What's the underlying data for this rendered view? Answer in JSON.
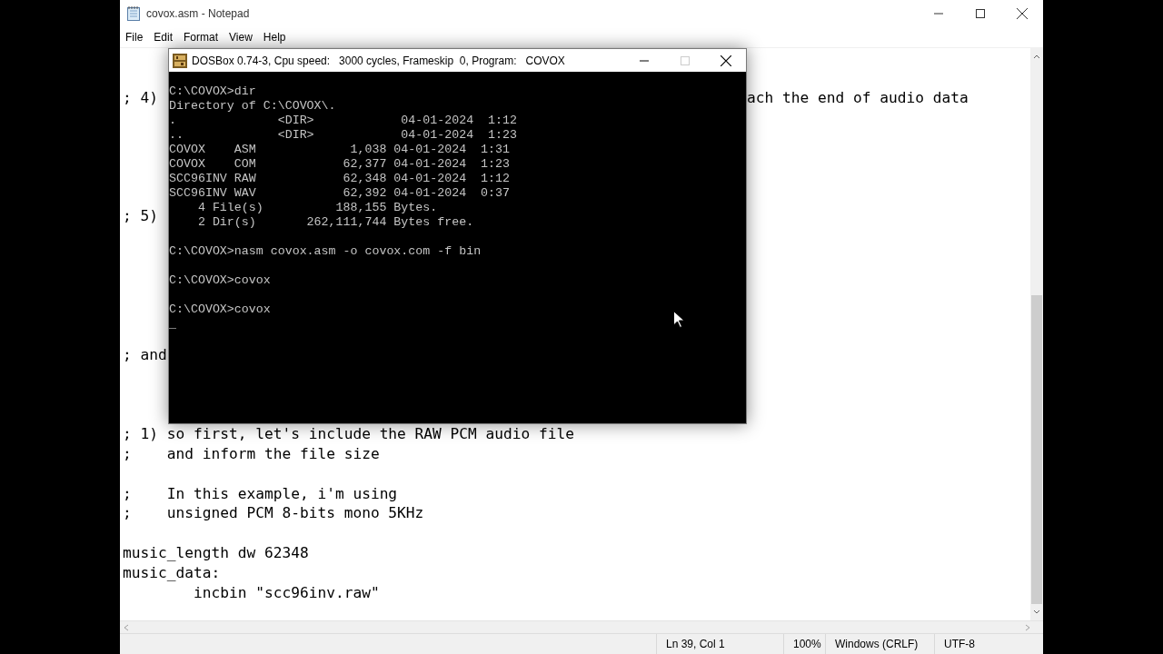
{
  "notepad": {
    "title": "covox.asm - Notepad",
    "menu": [
      "File",
      "Edit",
      "Format",
      "View",
      "Help"
    ],
    "lines": [
      {
        "kind": "blank"
      },
      {
        "kind": "blank"
      },
      {
        "kind": "text",
        "text": "; 4)",
        "tail": "ach the end of audio data"
      },
      {
        "kind": "blank"
      },
      {
        "kind": "blank"
      },
      {
        "kind": "blank"
      },
      {
        "kind": "blank"
      },
      {
        "kind": "blank"
      },
      {
        "kind": "text",
        "text": "; 5)"
      },
      {
        "kind": "blank"
      },
      {
        "kind": "blank"
      },
      {
        "kind": "blank"
      },
      {
        "kind": "blank"
      },
      {
        "kind": "blank"
      },
      {
        "kind": "blank"
      },
      {
        "kind": "text",
        "text": "; and"
      },
      {
        "kind": "blank"
      },
      {
        "kind": "blank"
      },
      {
        "kind": "blank"
      },
      {
        "kind": "text",
        "text": "; 1) so first, let's include the RAW PCM audio file"
      },
      {
        "kind": "text",
        "text": ";    and inform the file size"
      },
      {
        "kind": "blank"
      },
      {
        "kind": "text",
        "text": ";    In this example, i'm using"
      },
      {
        "kind": "text",
        "text": ";    unsigned PCM 8-bits mono 5KHz"
      },
      {
        "kind": "blank"
      },
      {
        "kind": "text",
        "text": "music_length dw 62348"
      },
      {
        "kind": "text",
        "text": "music_data:"
      },
      {
        "kind": "text",
        "text": "        incbin \"scc96inv.raw\""
      }
    ],
    "status_bar": [
      "Ln 39, Col 1",
      "100%",
      "Windows (CRLF)",
      "UTF-8"
    ]
  },
  "dosbox": {
    "title": "DOSBox 0.74-3, Cpu speed:   3000 cycles, Frameskip  0, Program:   COVOX",
    "maximize_disabled": true,
    "lines": [
      {
        "kind": "text",
        "text": "C:\\COVOX>dir"
      },
      {
        "kind": "text",
        "text": "Directory of C:\\COVOX\\."
      },
      {
        "kind": "text",
        "text": ".              <DIR>            04-01-2024  1:12"
      },
      {
        "kind": "text",
        "text": "..             <DIR>            04-01-2024  1:23"
      },
      {
        "kind": "text",
        "text": "COVOX    ASM             1,038 04-01-2024  1:31"
      },
      {
        "kind": "text",
        "text": "COVOX    COM            62,377 04-01-2024  1:23"
      },
      {
        "kind": "text",
        "text": "SCC96INV RAW            62,348 04-01-2024  1:12"
      },
      {
        "kind": "text",
        "text": "SCC96INV WAV            62,392 04-01-2024  0:37"
      },
      {
        "kind": "text",
        "text": "    4 File(s)          188,155 Bytes."
      },
      {
        "kind": "text",
        "text": "    2 Dir(s)       262,111,744 Bytes free."
      },
      {
        "kind": "blank"
      },
      {
        "kind": "text",
        "text": "C:\\COVOX>nasm covox.asm -o covox.com -f bin"
      },
      {
        "kind": "blank"
      },
      {
        "kind": "text",
        "text": "C:\\COVOX>covox"
      },
      {
        "kind": "blank"
      },
      {
        "kind": "text",
        "text": "C:\\COVOX>covox"
      },
      {
        "kind": "text",
        "text": "_"
      }
    ]
  }
}
